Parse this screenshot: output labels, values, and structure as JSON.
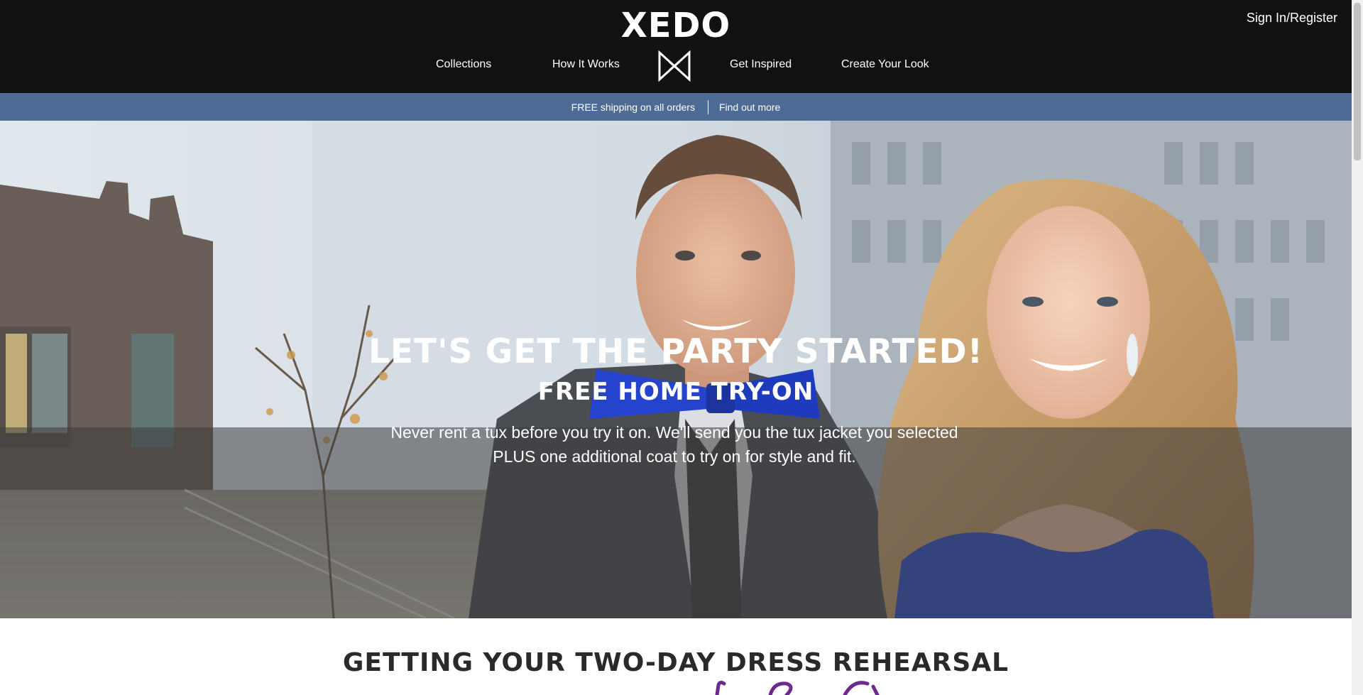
{
  "header": {
    "logo": "XEDO",
    "sign_in": "Sign In/Register",
    "nav": [
      "Collections",
      "How It Works",
      "Get Inspired",
      "Create Your Look"
    ]
  },
  "shipping_bar": {
    "text": "FREE shipping on all orders",
    "link": "Find out more"
  },
  "hero": {
    "title": "LET'S GET THE PARTY STARTED!",
    "subtitle": "FREE HOME TRY-ON",
    "body": "Never rent a tux before you try it on. We'll send you the tux jacket you selected PLUS one additional coat to try on for style and fit."
  },
  "section": {
    "heading": "GETTING YOUR TWO-DAY DRESS REHEARSAL"
  },
  "colors": {
    "header_bg": "#111111",
    "shipping_bar_bg": "#4e6b96",
    "accent_purple": "#6b2a8c"
  },
  "icons": [
    "bowtie-logo-icon"
  ]
}
